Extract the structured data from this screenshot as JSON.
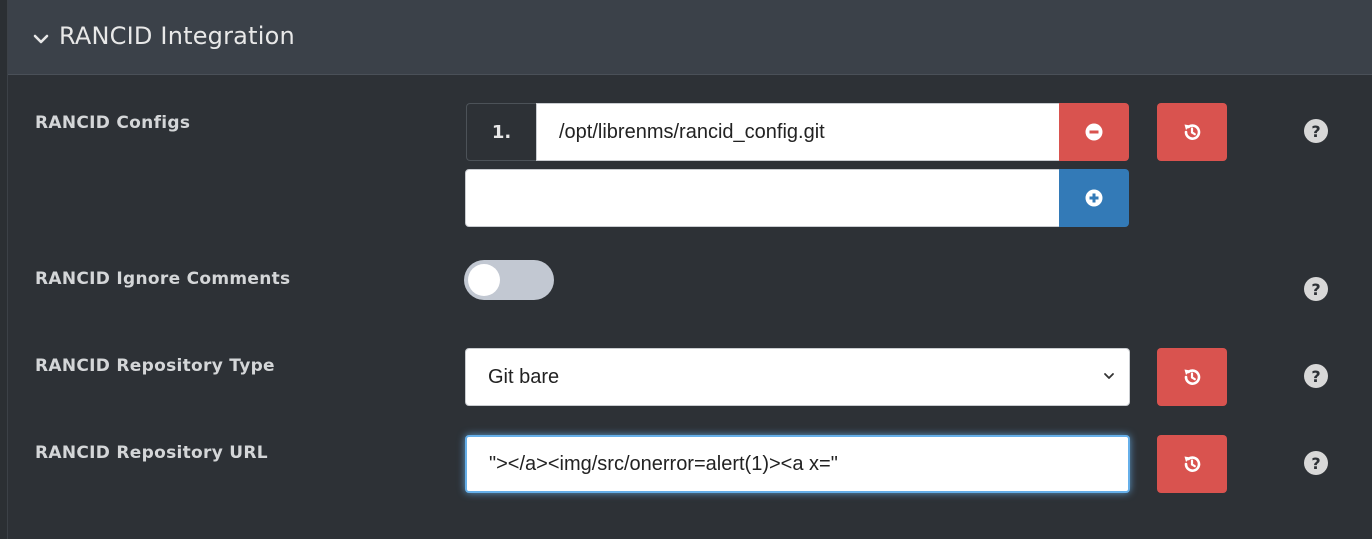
{
  "panel": {
    "title": "RANCID Integration"
  },
  "settings": {
    "configs": {
      "label": "RANCID Configs",
      "items": [
        {
          "index": "1.",
          "value": "/opt/librenms/rancid_config.git"
        }
      ],
      "new_value": ""
    },
    "ignore_comments": {
      "label": "RANCID Ignore Comments",
      "enabled": false
    },
    "repo_type": {
      "label": "RANCID Repository Type",
      "selected": "Git bare"
    },
    "repo_url": {
      "label": "RANCID Repository URL",
      "value": "\"></a><img/src/onerror=alert(1)><a x=\""
    }
  },
  "help": {
    "glyph": "?"
  },
  "colors": {
    "danger": "#d9534f",
    "primary": "#337ab7",
    "focus": "#66afe9"
  }
}
